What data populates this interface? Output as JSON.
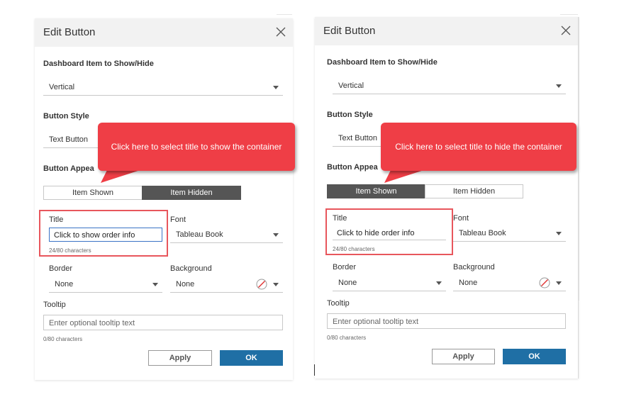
{
  "left": {
    "header_title": "Edit Button",
    "dashboard_item_label": "Dashboard Item to Show/Hide",
    "dashboard_item_value": "Vertical",
    "button_style_label": "Button Style",
    "button_style_value": "Text Button",
    "button_appearance_label": "Button Appea",
    "tab_shown": "Item Shown",
    "tab_hidden": "Item Hidden",
    "active_tab": "Item Hidden",
    "title_label": "Title",
    "title_value": "Click to show order info",
    "title_counter": "24/80 characters",
    "font_label": "Font",
    "font_value": "Tableau Book",
    "border_label": "Border",
    "border_value": "None",
    "background_label": "Background",
    "background_value": "None",
    "tooltip_label": "Tooltip",
    "tooltip_placeholder": "Enter optional tooltip text",
    "tooltip_counter": "0/80 characters",
    "apply_label": "Apply",
    "ok_label": "OK",
    "callout_text": "Click here to select title to show the container"
  },
  "right": {
    "header_title": "Edit Button",
    "dashboard_item_label": "Dashboard Item to Show/Hide",
    "dashboard_item_value": "Vertical",
    "button_style_label": "Button Style",
    "button_style_value": "Text Button",
    "button_appearance_label": "Button Appea",
    "tab_shown": "Item Shown",
    "tab_hidden": "Item Hidden",
    "active_tab": "Item Shown",
    "title_label": "Title",
    "title_value": "Click to hide order info",
    "title_counter": "24/80 characters",
    "font_label": "Font",
    "font_value": "Tableau Book",
    "border_label": "Border",
    "border_value": "None",
    "background_label": "Background",
    "background_value": "None",
    "tooltip_label": "Tooltip",
    "tooltip_placeholder": "Enter optional tooltip text",
    "tooltip_counter": "0/80 characters",
    "apply_label": "Apply",
    "ok_label": "OK",
    "callout_text": "Click here to select title to hide the container"
  },
  "colors": {
    "accent_ok": "#1f6fa5",
    "active_tab": "#555555",
    "callout_red": "#ef3e46",
    "highlight_box": "#e8565c"
  }
}
